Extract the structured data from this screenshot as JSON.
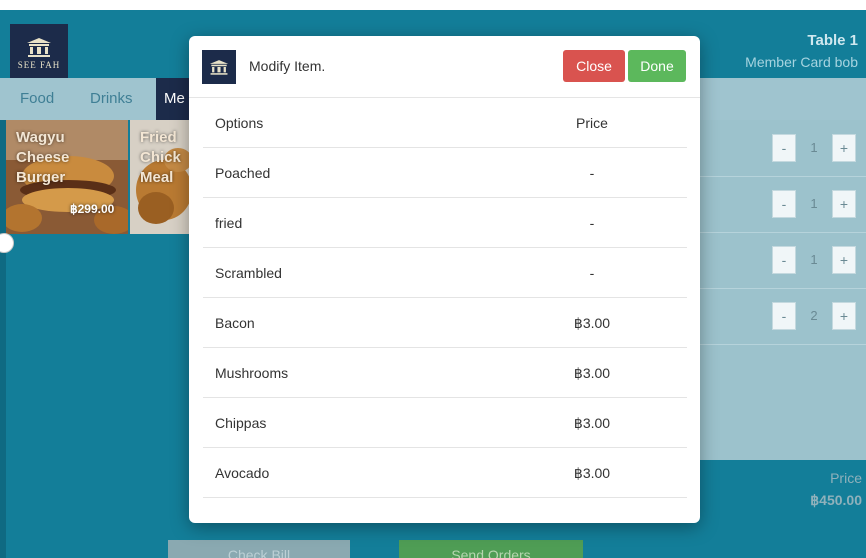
{
  "colors": {
    "header_blue": "#137e99",
    "navy": "#1c2b4a",
    "close_red": "#d9534f",
    "done_green": "#5cb85c"
  },
  "header": {
    "logo_text": "SEE FAH",
    "table_title": "Table 1",
    "member": "Member Card bob"
  },
  "tabs": [
    {
      "label": "Food",
      "active": false
    },
    {
      "label": "Drinks",
      "active": false
    },
    {
      "label": "Me",
      "active": true
    }
  ],
  "menu_tiles": [
    {
      "name": "Wagyu\nCheese\nBurger",
      "price": "฿299.00"
    },
    {
      "name": "Fried\nChick\nMeal",
      "price": ""
    }
  ],
  "order_rows": [
    {
      "minus": "-",
      "qty": "1",
      "plus": "+"
    },
    {
      "minus": "-",
      "qty": "1",
      "plus": "+"
    },
    {
      "minus": "-",
      "qty": "1",
      "plus": "+"
    },
    {
      "minus": "-",
      "qty": "2",
      "plus": "+"
    }
  ],
  "totals": {
    "price_label": "Price",
    "price_total": "฿450.00"
  },
  "footer": {
    "check_bill": "Check Bill",
    "send_orders": "Send Orders"
  },
  "modal": {
    "title": "Modify Item.",
    "close_label": "Close",
    "done_label": "Done",
    "col_options": "Options",
    "col_price": "Price",
    "options": [
      {
        "name": "Poached",
        "price": "-"
      },
      {
        "name": "fried",
        "price": "-"
      },
      {
        "name": "Scrambled",
        "price": "-"
      },
      {
        "name": "Bacon",
        "price": "฿3.00"
      },
      {
        "name": "Mushrooms",
        "price": "฿3.00"
      },
      {
        "name": "Chippas",
        "price": "฿3.00"
      },
      {
        "name": "Avocado",
        "price": "฿3.00"
      }
    ]
  }
}
